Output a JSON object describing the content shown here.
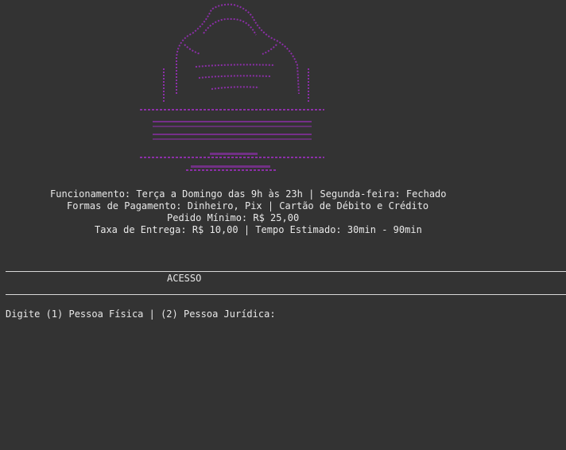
{
  "colors": {
    "background": "#333333",
    "text": "#e8e8e8",
    "logo": "#8c2fa8"
  },
  "logo": {
    "icon": "ascii-art-bag-logo"
  },
  "info": {
    "hours": "Funcionamento: Terça a Domingo das 9h às 23h | Segunda-feira: Fechado",
    "payment": "Formas de Pagamento: Dinheiro, Pix | Cartão de Débito e Crédito",
    "min_order": "Pedido Mínimo: R$ 25,00",
    "delivery": "Taxa de Entrega: R$ 10,00 | Tempo Estimado: 30min - 90min"
  },
  "section": {
    "title": "ACESSO"
  },
  "prompt": {
    "text": "Digite (1) Pessoa Física | (2) Pessoa Jurídica: "
  }
}
